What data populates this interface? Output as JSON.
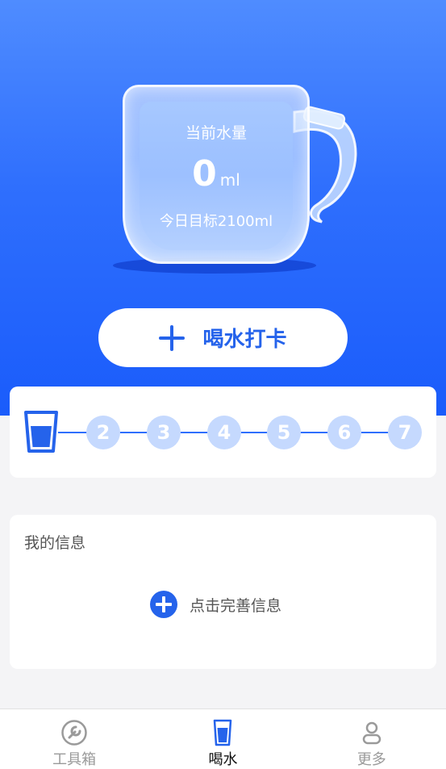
{
  "cup": {
    "title": "当前水量",
    "amount": "0",
    "unit": "ml",
    "goal": "今日目标2100ml"
  },
  "checkin": {
    "label": "喝水打卡",
    "icon": "plus-icon"
  },
  "progress": {
    "current_icon": "water-cup-icon",
    "steps": [
      "2",
      "3",
      "4",
      "5",
      "6",
      "7"
    ],
    "line_color": "#2f6ffd",
    "step_color": "#c5d9fe"
  },
  "info": {
    "title": "我的信息",
    "action_label": "点击完善信息",
    "action_icon": "plus-circle-icon"
  },
  "nav": {
    "items": [
      {
        "label": "工具箱",
        "icon": "wrench-icon",
        "active": false
      },
      {
        "label": "喝水",
        "icon": "water-cup-icon",
        "active": true
      },
      {
        "label": "更多",
        "icon": "person-icon",
        "active": false
      }
    ]
  },
  "colors": {
    "accent": "#2563eb",
    "hero_top": "#4f8cff",
    "hero_bottom": "#1a5cfb",
    "background": "#f4f4f6"
  }
}
